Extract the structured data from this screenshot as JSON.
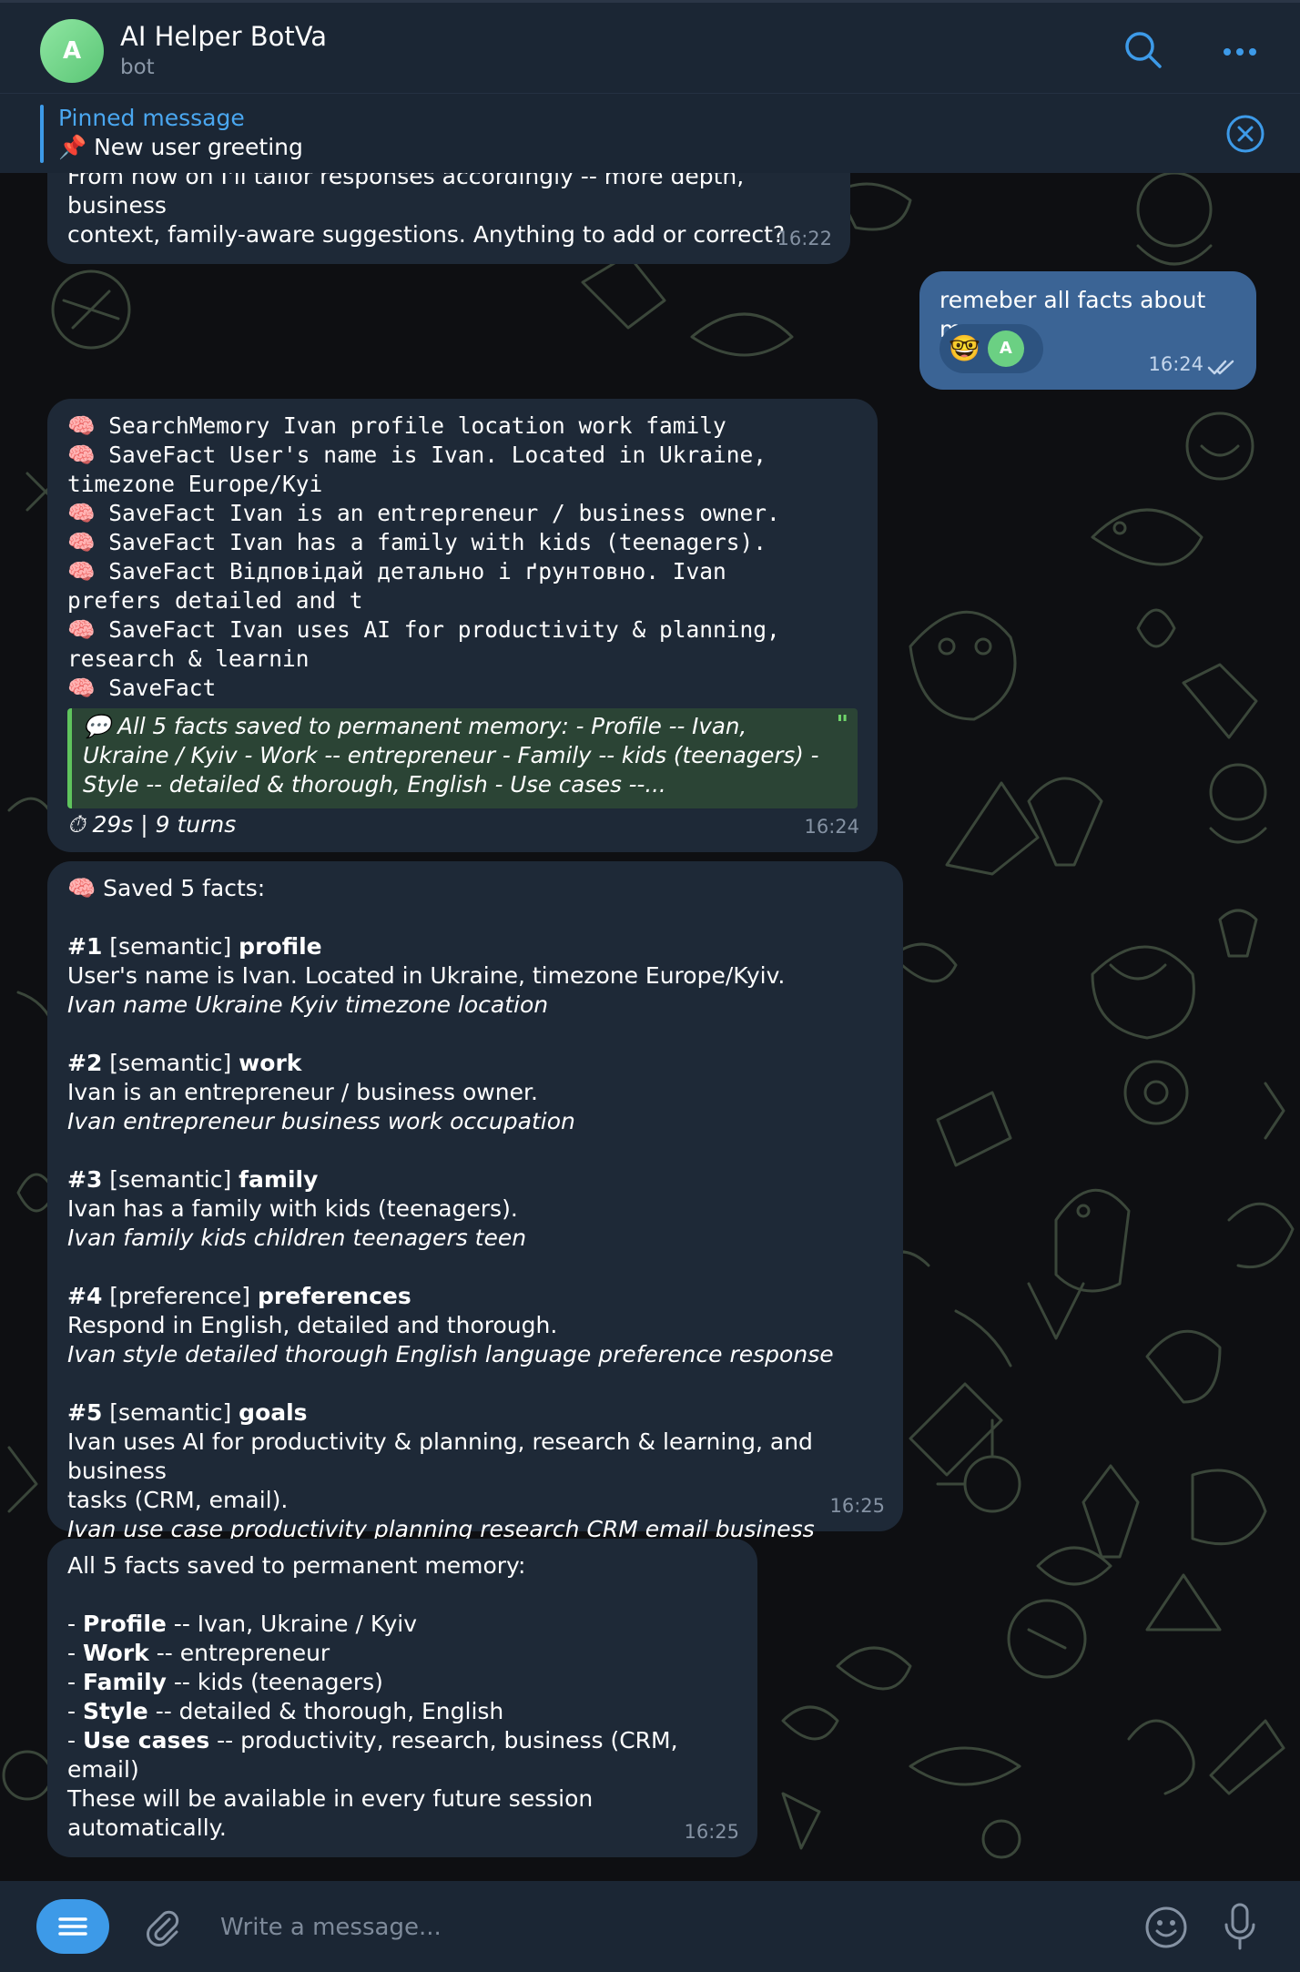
{
  "header": {
    "avatar_letter": "A",
    "title": "AI Helper BotVa",
    "subtitle": "bot"
  },
  "pinned": {
    "title": "Pinned message",
    "text": "📌 New user greeting"
  },
  "messages": {
    "m1": {
      "line1": "From now on I'll tailor responses accordingly -- more depth, business",
      "line2": "context, family-aware suggestions. Anything to add or correct?",
      "time": "16:22"
    },
    "m2": {
      "text": "remeber all facts about me",
      "reaction_emoji": "🤓",
      "reaction_avatar": "A",
      "time": "16:24"
    },
    "m3": {
      "lines": [
        "🧠 SearchMemory Ivan profile location work family",
        "🧠 SaveFact User's name is Ivan. Located in Ukraine,",
        "timezone Europe/Kyi",
        "🧠 SaveFact Ivan is an entrepreneur / business owner.",
        "🧠 SaveFact Ivan has a family with kids (teenagers).",
        "🧠 SaveFact Відповідай детально і ґрунтовно. Ivan",
        "prefers detailed and t",
        "🧠 SaveFact Ivan uses AI for productivity & planning,",
        "research & learnin",
        "🧠 SaveFact"
      ],
      "quote_lines": [
        "💬 All 5 facts saved to permanent memory:  - Profile -- Ivan,",
        "Ukraine / Kyiv - Work -- entrepreneur - Family -- kids (teenagers) -",
        "Style -- detailed & thorough, English - Use cases --..."
      ],
      "quote_mark": "\"",
      "stats": "⏱ 29s | 9 turns",
      "time": "16:24"
    },
    "m4": {
      "heading": "🧠 Saved 5 facts:",
      "facts": [
        {
          "num": "#1",
          "type": " [semantic] ",
          "key": "profile",
          "text": "User's name is Ivan. Located in Ukraine, timezone Europe/Kyiv.",
          "tags": "Ivan name Ukraine Kyiv timezone location"
        },
        {
          "num": "#2",
          "type": " [semantic] ",
          "key": "work",
          "text": "Ivan is an entrepreneur / business owner.",
          "tags": "Ivan entrepreneur business work occupation"
        },
        {
          "num": "#3",
          "type": " [semantic] ",
          "key": "family",
          "text": "Ivan has a family with kids (teenagers).",
          "tags": "Ivan family kids children teenagers teen"
        },
        {
          "num": "#4",
          "type": " [preference] ",
          "key": "preferences",
          "text": "Respond in English, detailed and thorough.",
          "tags": "Ivan style detailed thorough English language preference response"
        },
        {
          "num": "#5",
          "type": " [semantic] ",
          "key": "goals",
          "text": "Ivan uses AI for productivity & planning, research & learning, and business",
          "text2": "tasks (CRM, email).",
          "tags": "Ivan use case productivity planning research CRM email business"
        }
      ],
      "time": "16:25"
    },
    "m5": {
      "intro": "All 5 facts saved to permanent memory:",
      "items": [
        {
          "key": "Profile",
          "value": " -- Ivan, Ukraine / Kyiv"
        },
        {
          "key": "Work",
          "value": " -- entrepreneur"
        },
        {
          "key": "Family",
          "value": " -- kids (teenagers)"
        },
        {
          "key": "Style",
          "value": " -- detailed & thorough, English"
        },
        {
          "key": "Use cases",
          "value": " -- productivity, research, business (CRM, email)"
        }
      ],
      "bullet": "- ",
      "outro": "These will be available in every future session automatically.",
      "time": "16:25"
    }
  },
  "composer": {
    "placeholder": "Write a message..."
  },
  "colors": {
    "accent": "#3d9ae8",
    "incoming_bubble": "#1e2937",
    "outgoing_bubble": "#3b6495",
    "quote_bar": "#5fc45d",
    "header": "#1b2634"
  },
  "icons": [
    "search-icon",
    "more-icon",
    "close-circle-icon",
    "menu-icon",
    "attach-icon",
    "emoji-icon",
    "mic-icon",
    "double-check-icon",
    "timer-icon"
  ]
}
